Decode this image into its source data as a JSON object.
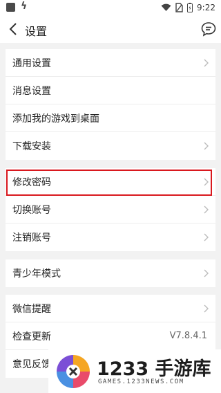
{
  "status_bar": {
    "time": "9:22",
    "icons": [
      "app-icon",
      "bolt-icon",
      "wifi-icon",
      "no-sim-icon",
      "battery-icon"
    ]
  },
  "nav": {
    "title": "设置",
    "back_icon": "chevron-left-icon",
    "right_icon": "message-icon"
  },
  "groups": [
    {
      "items": [
        {
          "label": "通用设置",
          "chevron": true
        },
        {
          "label": "消息设置",
          "chevron": false
        },
        {
          "label": "添加我的游戏到桌面",
          "chevron": false
        },
        {
          "label": "下载安装",
          "chevron": true
        }
      ]
    },
    {
      "items": [
        {
          "label": "修改密码",
          "chevron": true,
          "highlighted": true
        },
        {
          "label": "切换账号",
          "chevron": true
        },
        {
          "label": "注销账号",
          "chevron": true
        }
      ]
    },
    {
      "items": [
        {
          "label": "青少年模式",
          "chevron": true
        }
      ]
    },
    {
      "items": [
        {
          "label": "微信提醒",
          "chevron": true
        },
        {
          "label": "检查更新",
          "value": "V7.8.4.1",
          "chevron": false
        },
        {
          "label": "意见反馈",
          "chevron": false
        }
      ]
    }
  ],
  "highlight_color": "#d9181e",
  "watermark": {
    "brand": "1233 手游库",
    "url": "GAMES.1233NEWS.COM"
  }
}
